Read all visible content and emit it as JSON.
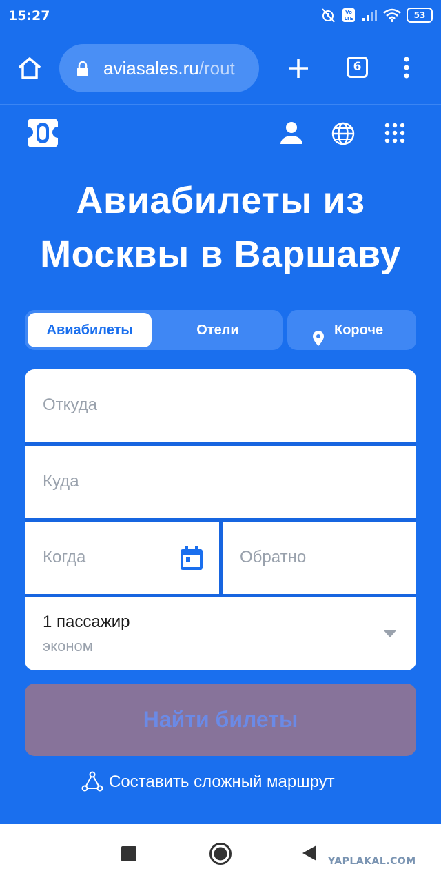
{
  "status_bar": {
    "time": "15:27",
    "battery": "53",
    "lte_label": "Vo LTE"
  },
  "browser": {
    "url_main": "aviasales.ru",
    "url_path": "/rout",
    "tab_count": "6"
  },
  "page": {
    "headline_line1": "Авиабилеты из",
    "headline_line2": "Москвы в Варшаву",
    "tabs": {
      "flights": "Авиабилеты",
      "hotels": "Отели",
      "short": "Короче"
    },
    "form": {
      "from_placeholder": "Откуда",
      "to_placeholder": "Куда",
      "when_placeholder": "Когда",
      "back_placeholder": "Обратно",
      "passengers": "1 пассажир",
      "cabin_class": "эконом"
    },
    "search_button": "Найти билеты",
    "complex_route_link": "Составить сложный маршрут"
  },
  "watermark": "YAPLAKAL.COM",
  "colors": {
    "brand_blue": "#1a6fee",
    "search_button_bg": "#87739a",
    "search_button_text": "#6b8ae6"
  }
}
